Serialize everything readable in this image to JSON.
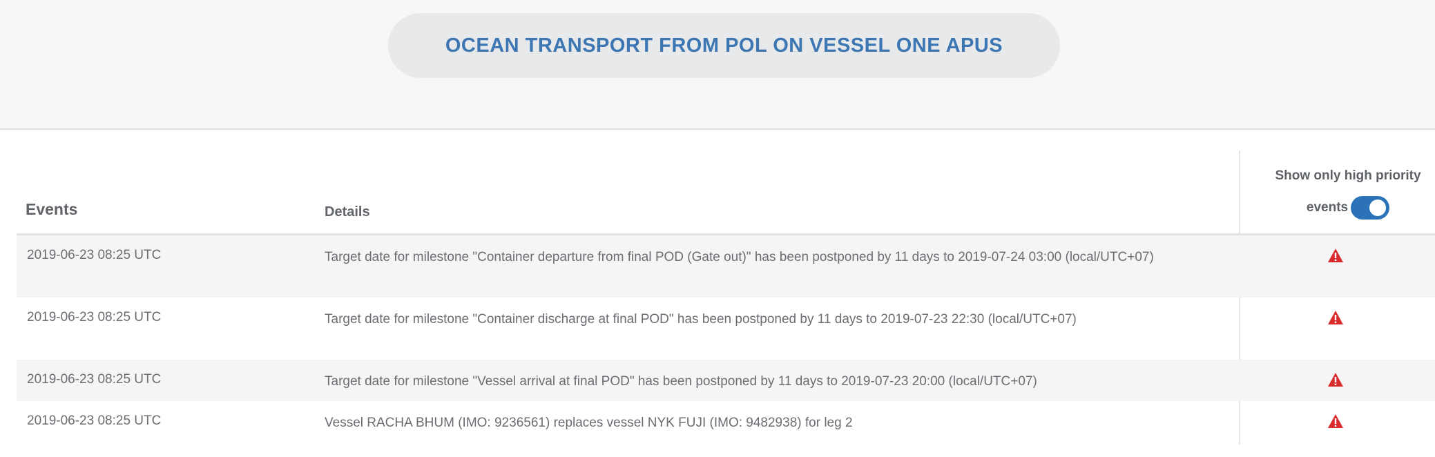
{
  "leg_title": "OCEAN TRANSPORT FROM POL ON VESSEL ONE APUS",
  "table": {
    "col_events": "Events",
    "col_details": "Details",
    "filter_label_line1": "Show only high priority",
    "filter_label_line2": "events",
    "filter_on": true,
    "rows": [
      {
        "date": "2019-06-23 08:25 UTC",
        "detail": "Target date for milestone \"Container departure from final POD (Gate out)\" has been postponed by 11 days to 2019-07-24 03:00 (local/UTC+07)",
        "priority_icon": "warning-triangle-icon"
      },
      {
        "date": "2019-06-23 08:25 UTC",
        "detail": "Target date for milestone \"Container discharge at final POD\" has been postponed by 11 days to 2019-07-23 22:30 (local/UTC+07)",
        "priority_icon": "warning-triangle-icon"
      },
      {
        "date": "2019-06-23 08:25 UTC",
        "detail": "Target date for milestone \"Vessel arrival at final POD\" has been postponed by 11 days to 2019-07-23 20:00 (local/UTC+07)",
        "priority_icon": "warning-triangle-icon"
      },
      {
        "date": "2019-06-23 08:25 UTC",
        "detail": "Vessel RACHA BHUM (IMO: 9236561) replaces vessel NYK FUJI (IMO: 9482938) for leg 2",
        "priority_icon": "warning-triangle-icon"
      }
    ]
  },
  "colors": {
    "accent": "#3c76b3",
    "toggle": "#2b72b8",
    "alert": "#d92b2b"
  }
}
